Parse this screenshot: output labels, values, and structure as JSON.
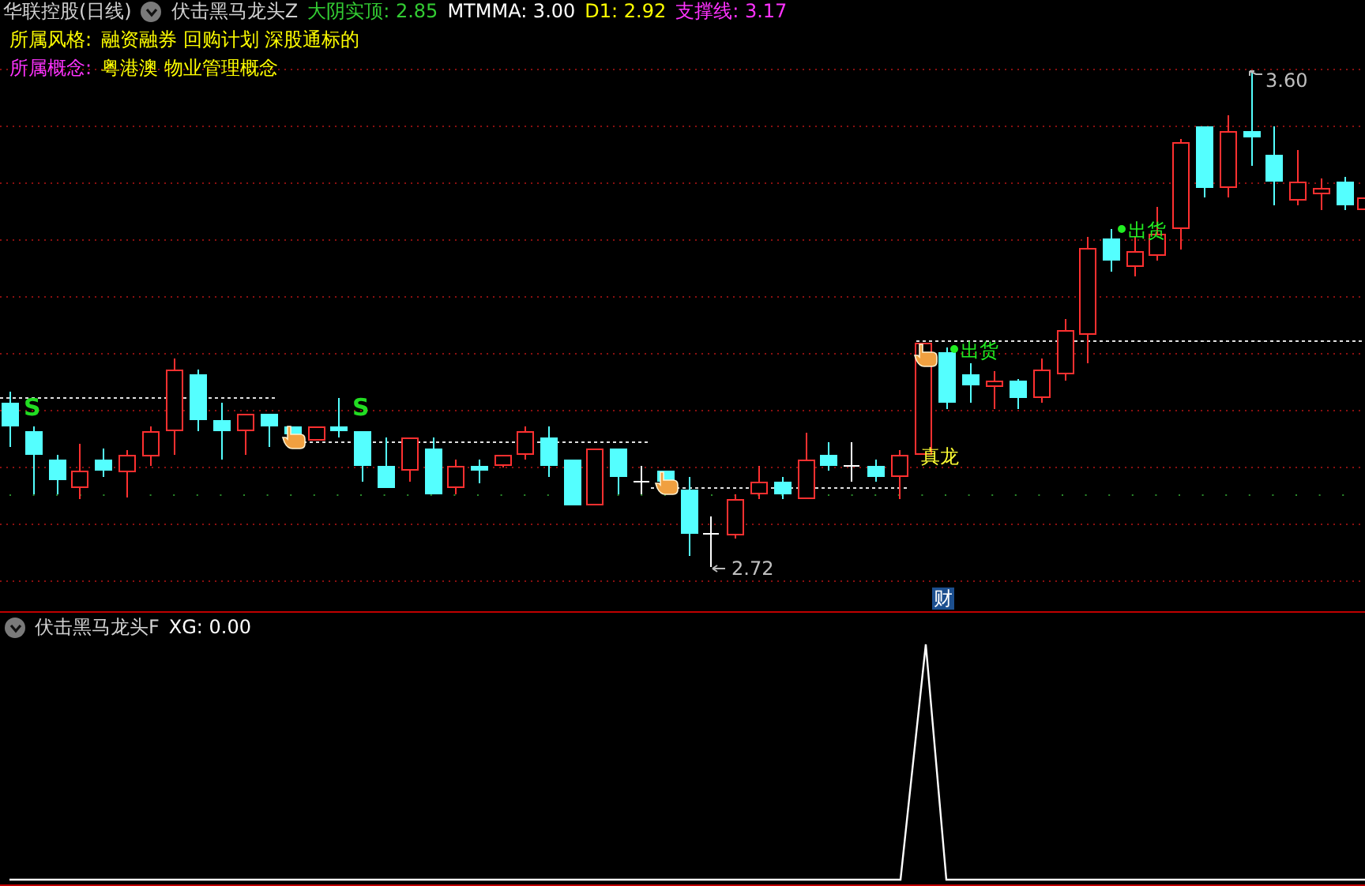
{
  "main_panel": {
    "stock": "华联控股(日线)",
    "indicator": "伏击黑马龙头Z",
    "values": [
      {
        "text": "大阴实顶: 2.85",
        "color": "#33cc33"
      },
      {
        "text": "MTMMA: 3.00",
        "color": "#ffffff"
      },
      {
        "text": "D1: 2.92",
        "color": "#ffff00"
      },
      {
        "text": "支撑线: 3.17",
        "color": "#ff33ff"
      }
    ],
    "info": [
      {
        "label": "所属风格:",
        "value": "融资融券 回购计划 深股通标的",
        "color": "#ffff00"
      },
      {
        "label": "所属概念:",
        "value": "粤港澳 物业管理概念",
        "color": "#ff33ff"
      }
    ],
    "marks": [
      {
        "kind": "signal",
        "text": "S"
      },
      {
        "kind": "signal",
        "text": "S"
      },
      {
        "kind": "sell",
        "text": "出货"
      },
      {
        "kind": "sell",
        "text": "出货"
      },
      {
        "kind": "tag",
        "text": "真龙"
      },
      {
        "kind": "low",
        "text": "2.72"
      },
      {
        "kind": "high",
        "text": "3.60"
      }
    ],
    "finance_badge": "财"
  },
  "sub_panel": {
    "indicator": "伏击黑马龙头F",
    "values": [
      {
        "text": "XG: 0.00",
        "color": "#ffffff"
      }
    ]
  }
}
